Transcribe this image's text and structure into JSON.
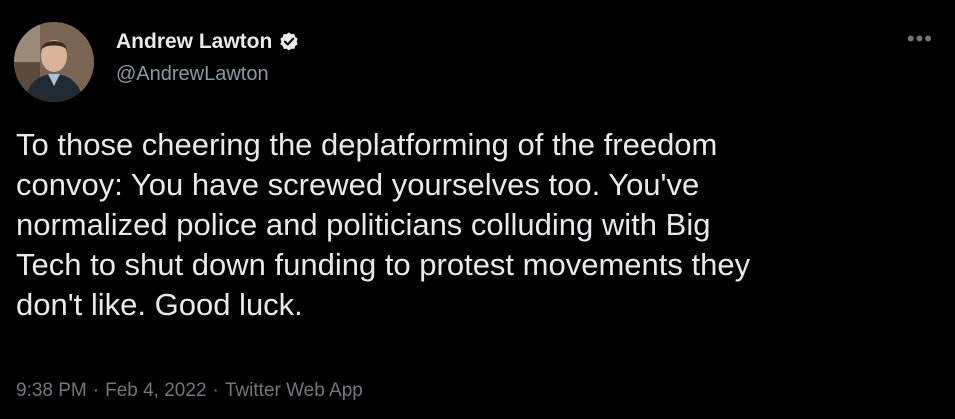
{
  "author": {
    "display_name": "Andrew Lawton",
    "handle": "@AndrewLawton",
    "verified": true
  },
  "tweet": {
    "text": "To those cheering the deplatforming of the freedom\nconvoy: You have screwed yourselves too. You've\nnormalized police and politicians colluding with Big\nTech to shut down funding to protest movements they\ndon't like. Good luck."
  },
  "meta": {
    "time": "9:38 PM",
    "separator": "·",
    "date": "Feb 4, 2022",
    "source": "Twitter Web App"
  },
  "icons": {
    "more": "more-options-icon",
    "verified": "verified-badge-icon"
  },
  "colors": {
    "background": "#000000",
    "primary_text": "#e7e9ea",
    "secondary_text": "#71767b",
    "verified_badge": "#e7e9ea"
  }
}
